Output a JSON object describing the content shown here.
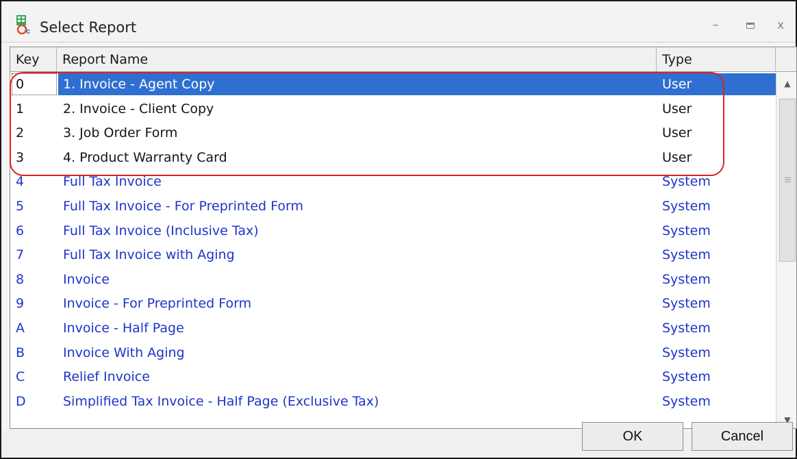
{
  "window": {
    "title": "Select Report",
    "controls": {
      "minimize": "–",
      "maximize": "□",
      "close": "x"
    }
  },
  "table": {
    "columns": {
      "key": "Key",
      "name": "Report Name",
      "type": "Type"
    },
    "rows": [
      {
        "key": "0",
        "name": "1. Invoice - Agent Copy",
        "type": "User"
      },
      {
        "key": "1",
        "name": "2. Invoice - Client Copy",
        "type": "User"
      },
      {
        "key": "2",
        "name": "3. Job Order Form",
        "type": "User"
      },
      {
        "key": "3",
        "name": "4. Product Warranty Card",
        "type": "User"
      },
      {
        "key": "4",
        "name": "Full Tax Invoice",
        "type": "System"
      },
      {
        "key": "5",
        "name": "Full Tax Invoice - For Preprinted Form",
        "type": "System"
      },
      {
        "key": "6",
        "name": "Full Tax Invoice (Inclusive Tax)",
        "type": "System"
      },
      {
        "key": "7",
        "name": "Full Tax Invoice with Aging",
        "type": "System"
      },
      {
        "key": "8",
        "name": "Invoice",
        "type": "System"
      },
      {
        "key": "9",
        "name": "Invoice - For Preprinted Form",
        "type": "System"
      },
      {
        "key": "A",
        "name": "Invoice - Half Page",
        "type": "System"
      },
      {
        "key": "B",
        "name": "Invoice With Aging",
        "type": "System"
      },
      {
        "key": "C",
        "name": "Relief Invoice",
        "type": "System"
      },
      {
        "key": "D",
        "name": "Simplified Tax Invoice - Half Page (Exclusive Tax)",
        "type": "System"
      }
    ],
    "selected_key": "0"
  },
  "buttons": {
    "ok": "OK",
    "cancel": "Cancel"
  },
  "colors": {
    "selection": "#2e6fd1",
    "system_text": "#1d34c9",
    "user_text": "#141414",
    "annotation": "#e0201c"
  },
  "icons": {
    "app": "report-icon",
    "scroll_up": "arrow-up-icon",
    "scroll_down": "arrow-down-icon"
  }
}
